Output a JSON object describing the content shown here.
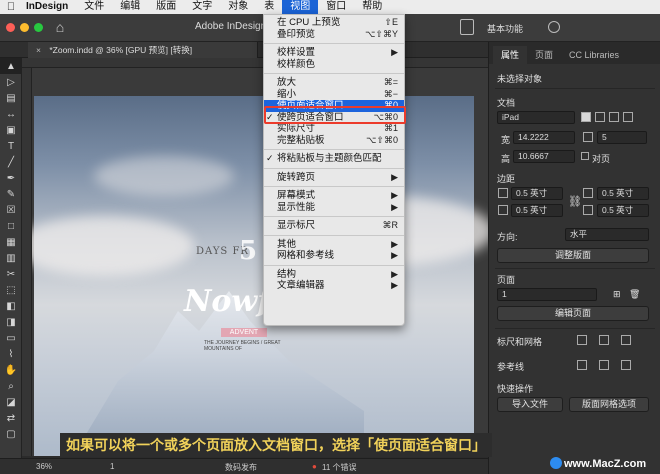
{
  "menubar": {
    "items": [
      "InDesign",
      "文件",
      "编辑",
      "版面",
      "文字",
      "对象",
      "表",
      "视图",
      "窗口",
      "帮助"
    ],
    "active_index": 7
  },
  "app": {
    "title": "Adobe InDesign",
    "workspace": "基本功能"
  },
  "document_tab": {
    "label": "*Zoom.indd @ 36% [GPU 预览] [转换]"
  },
  "view_menu": {
    "rows": [
      {
        "label": "在 CPU 上预览",
        "shortcut": "⇧E"
      },
      {
        "label": "叠印预览",
        "shortcut": "⌥⇧⌘Y"
      },
      {
        "sep": true
      },
      {
        "label": "校样设置",
        "submenu": "▶"
      },
      {
        "label": "校样颜色"
      },
      {
        "sep": true
      },
      {
        "label": "放大",
        "shortcut": "⌘="
      },
      {
        "label": "缩小",
        "shortcut": "⌘−"
      },
      {
        "label": "使页面适合窗口",
        "shortcut": "⌘0",
        "highlighted": true
      },
      {
        "label": "使跨页适合窗口",
        "shortcut": "⌥⌘0",
        "checked": true
      },
      {
        "label": "实际尺寸",
        "shortcut": "⌘1"
      },
      {
        "label": "完整粘贴板",
        "shortcut": "⌥⇧⌘0"
      },
      {
        "sep": true
      },
      {
        "label": "将粘贴板与主题颜色匹配",
        "checked": true
      },
      {
        "sep": true
      },
      {
        "label": "旋转跨页",
        "submenu": "▶"
      },
      {
        "sep": true
      },
      {
        "label": "屏幕模式",
        "submenu": "▶"
      },
      {
        "label": "显示性能",
        "submenu": "▶"
      },
      {
        "sep": true
      },
      {
        "label": "显示标尺",
        "shortcut": "⌘R"
      },
      {
        "sep": true
      },
      {
        "label": "其他",
        "submenu": "▶"
      },
      {
        "label": "网格和参考线",
        "submenu": "▶"
      },
      {
        "sep": true
      },
      {
        "label": "结构",
        "submenu": "▶"
      },
      {
        "label": "文章编辑器",
        "submenu": "▶"
      }
    ]
  },
  "page_art": {
    "days": "DAYS FR",
    "big": "5",
    "now": "Nowf",
    "pink": "ADVENT",
    "small": "THE JOURNEY BEGINS / GREAT MOUNTAINS OF"
  },
  "panel": {
    "tabs": [
      "属性",
      "页面",
      "CC Libraries"
    ],
    "no_selection": "未选择对象",
    "doc_label": "文档",
    "preset": "iPad",
    "width_label": "宽",
    "width": "14.2222",
    "height_label": "高",
    "height": "10.6667",
    "pages_count": "5",
    "facing": "对页",
    "margins_label": "边距",
    "margins": [
      "0.5 英寸",
      "0.5 英寸",
      "0.5 英寸",
      "0.5 英寸"
    ],
    "orientation_label": "方向:",
    "orientation": "水平",
    "adjust_layout": "调整版面",
    "pages_label": "页面",
    "page_num": "1",
    "edit_page": "编辑页面",
    "ruler_grid": "标尺和网格",
    "guides": "参考线",
    "quick_actions": "快速操作",
    "import_file": "导入文件",
    "layout_grid": "版面网格选项"
  },
  "status": {
    "zoom": "36%",
    "page": "1",
    "preflight": "数码发布",
    "errors": "11 个错误"
  },
  "caption": "如果可以将一个或多个页面放入文档窗口，选择「使页面适合窗口」",
  "watermark": "www.MacZ.com",
  "colors": {
    "menu_highlight": "#1d64dc",
    "callout_border": "#ec3b2b",
    "caption_text": "#f1d25a"
  }
}
